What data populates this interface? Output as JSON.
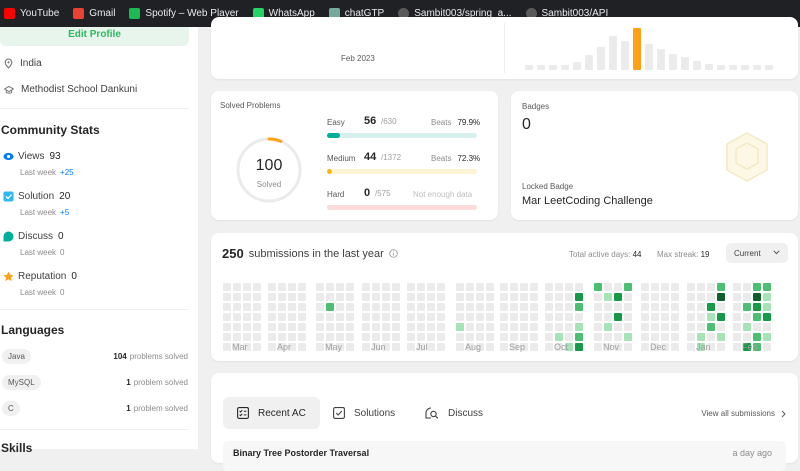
{
  "bookmarks": [
    {
      "label": "YouTube",
      "color": "#ff0000",
      "icon": "youtube-icon"
    },
    {
      "label": "Gmail",
      "color": "#ea4335",
      "icon": "gmail-icon"
    },
    {
      "label": "Spotify – Web Player",
      "color": "#1db954",
      "icon": "spotify-icon"
    },
    {
      "label": "WhatsApp",
      "color": "#25d366",
      "icon": "whatsapp-icon"
    },
    {
      "label": "chatGTP",
      "color": "#74aa9c",
      "icon": "chatgpt-icon"
    },
    {
      "label": "Sambit003/spring_a...",
      "color": "#5a5a5a",
      "icon": "github-icon"
    },
    {
      "label": "Sambit003/API",
      "color": "#5a5a5a",
      "icon": "github-icon"
    }
  ],
  "profile": {
    "edit_label": "Edit Profile",
    "location": "India",
    "school": "Methodist School Dankuni"
  },
  "community": {
    "title": "Community Stats",
    "last_week": "Last week",
    "views": {
      "label": "Views",
      "value": "93",
      "delta": "+25"
    },
    "solution": {
      "label": "Solution",
      "value": "20",
      "delta": "+5"
    },
    "discuss": {
      "label": "Discuss",
      "value": "0",
      "delta": "0"
    },
    "reputation": {
      "label": "Reputation",
      "value": "0",
      "delta": "0"
    }
  },
  "languages": {
    "title": "Languages",
    "items": [
      {
        "name": "Java",
        "count": "104",
        "unit": "problems solved"
      },
      {
        "name": "MySQL",
        "count": "1",
        "unit": "problem solved"
      },
      {
        "name": "C",
        "count": "1",
        "unit": "problem solved"
      }
    ]
  },
  "skills_title": "Skills",
  "contest": {
    "date_label": "Feb 2023"
  },
  "solved": {
    "title": "Solved Problems",
    "total": "100",
    "total_label": "Solved",
    "progress": 0.0625,
    "easy": {
      "label": "Easy",
      "count": "56",
      "total": "/630",
      "beats_label": "Beats",
      "beats": "79.9%",
      "fraction": 0.089
    },
    "medium": {
      "label": "Medium",
      "count": "44",
      "total": "/1372",
      "beats_label": "Beats",
      "beats": "72.3%",
      "fraction": 0.032
    },
    "hard": {
      "label": "Hard",
      "count": "0",
      "total": "/575",
      "beats": "Not enough data",
      "fraction": 0
    }
  },
  "badges": {
    "title": "Badges",
    "count": "0",
    "locked_label": "Locked Badge",
    "locked_name": "Mar LeetCoding Challenge"
  },
  "submissions": {
    "count": "250",
    "label": "submissions in the last year",
    "active_label": "Total active days:",
    "active": "44",
    "streak_label": "Max streak:",
    "streak": "19",
    "select": "Current",
    "months": [
      "Mar",
      "Apr",
      "May",
      "Jun",
      "Jul",
      "Aug",
      "Sep",
      "Oct",
      "Nov",
      "Dec",
      "Jan",
      "Feb"
    ]
  },
  "recent": {
    "tabs": [
      "Recent AC",
      "Solutions",
      "Discuss"
    ],
    "view_all": "View all submissions",
    "first_title": "Binary Tree Postorder Traversal",
    "first_time": "a day ago"
  },
  "colors": {
    "easy": "#00af9b",
    "medium": "#ffb800",
    "hard": "#ef4743",
    "accent": "#2cbb5d"
  }
}
